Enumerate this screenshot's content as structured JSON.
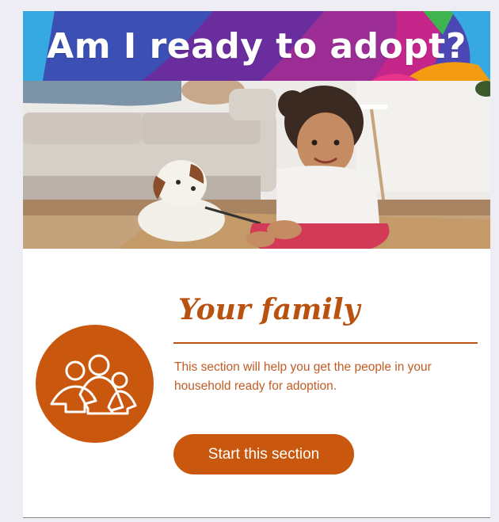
{
  "banner": {
    "title": "Am I ready to adopt?",
    "colors": [
      "#3b5fc0",
      "#7a2d9e",
      "#c0267e",
      "#e6338b",
      "#36a9e1",
      "#f39c12",
      "#3fb34f"
    ]
  },
  "photo": {
    "subject": "child-with-dog-photo"
  },
  "section": {
    "icon": "family-icon",
    "title": "Your family",
    "description": "This section will help you get the people in your household ready for adoption.",
    "button_label": "Start this section",
    "accent": "#c9580e"
  }
}
